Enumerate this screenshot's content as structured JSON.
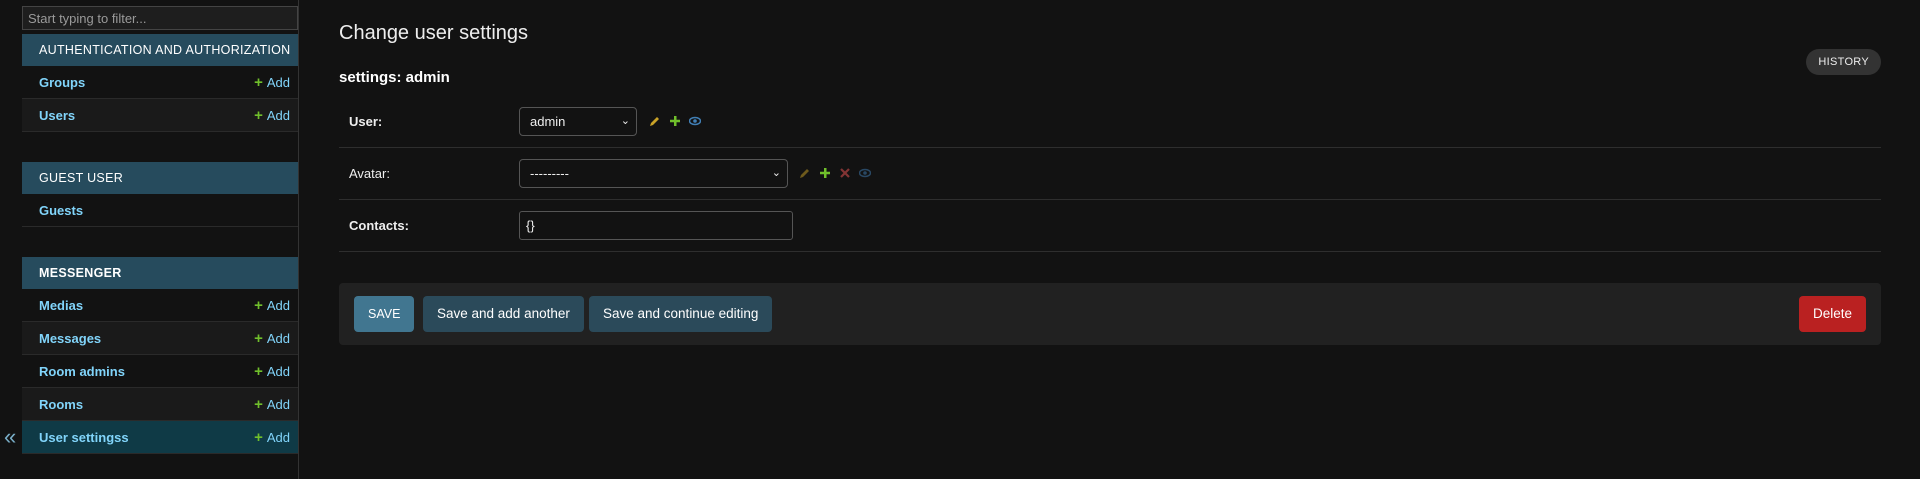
{
  "sidebar": {
    "filter_placeholder": "Start typing to filter...",
    "collapse_glyph": "«",
    "modules": [
      {
        "caption": "Authentication and Authorization",
        "models": [
          {
            "name": "Groups",
            "add": "Add"
          },
          {
            "name": "Users",
            "add": "Add"
          }
        ]
      },
      {
        "caption": "Guest user",
        "models": [
          {
            "name": "Guests"
          }
        ]
      },
      {
        "caption": "Messenger",
        "models": [
          {
            "name": "Medias",
            "add": "Add"
          },
          {
            "name": "Messages",
            "add": "Add"
          },
          {
            "name": "Room admins",
            "add": "Add"
          },
          {
            "name": "Rooms",
            "add": "Add"
          },
          {
            "name": "User settingss",
            "add": "Add",
            "current": true
          }
        ]
      }
    ]
  },
  "main": {
    "page_title": "Change user settings",
    "history_label": "History",
    "object_title": "settings: admin",
    "fields": {
      "user": {
        "label": "User:",
        "value": "admin"
      },
      "avatar": {
        "label": "Avatar:",
        "value": "---------"
      },
      "contacts": {
        "label": "Contacts:",
        "value": "{}"
      }
    },
    "buttons": {
      "save": "Save",
      "save_add_another": "Save and add another",
      "save_continue": "Save and continue editing",
      "delete": "Delete"
    }
  },
  "colors": {
    "accent": "#417690",
    "caption_bg": "#264b5d",
    "link": "#81d4fa",
    "add_green": "#70bf2b",
    "delete_red": "#ba2121"
  }
}
